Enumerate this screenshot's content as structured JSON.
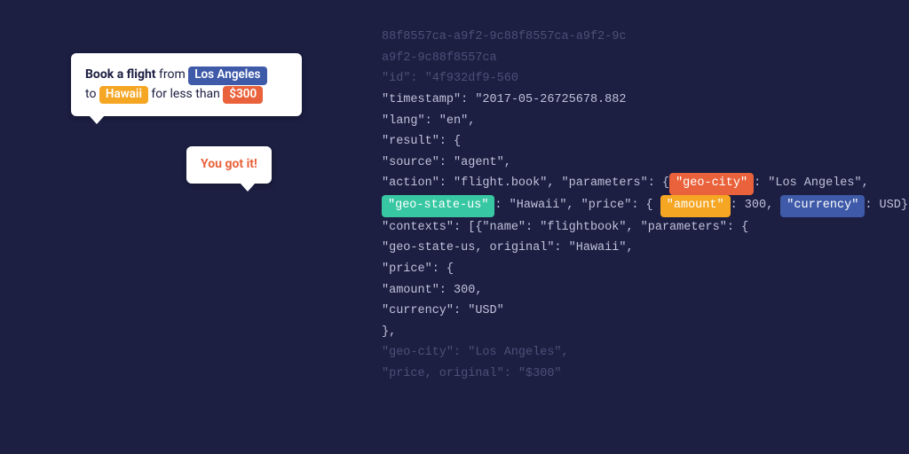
{
  "chat": {
    "request": {
      "prefix_bold": "Book a flight",
      "from_word": " from ",
      "city_pill": "Los Angeles",
      "to_word": "to ",
      "state_pill": "Hawaii",
      "mid_text": " for less than ",
      "price_pill": "$300"
    },
    "reply": "You got it!"
  },
  "highlights": {
    "geo_city": "\"geo-city\"",
    "geo_state": "\"geo-state-us\"",
    "amount": "\"amount\"",
    "currency": "\"currency\""
  },
  "code": {
    "l1": "88f8557ca-a9f2-9c88f8557ca-a9f2-9c",
    "l2": "a9f2-9c88f8557ca",
    "l3": "\"id\": \"4f932df9-560",
    "l4": "\"timestamp\": \"2017-05-26725678.882",
    "l5": "\"lang\": \"en\",",
    "l6": "\"result\": {",
    "l7": "\"source\": \"agent\",",
    "l8a": "\"action\": \"flight.book\", \"parameters\": {",
    "l8b": ": \"Los Angeles\",",
    "l9a": ": \"Hawaii\", \"price\": { ",
    "l9b": ": 300, ",
    "l9c": ": USD},",
    "l10": "\"contexts\": [{\"name\": \"flightbook\", \"parameters\": {",
    "l11": "\"geo-state-us, original\": \"Hawaii\",",
    "l12": "\"price\": {",
    "l13": "\"amount\": 300,",
    "l14": "\"currency\": \"USD\"",
    "l15": "},",
    "l16": "\"geo-city\": \"Los Angeles\",",
    "l17": "\"price, original\": \"$300\""
  }
}
